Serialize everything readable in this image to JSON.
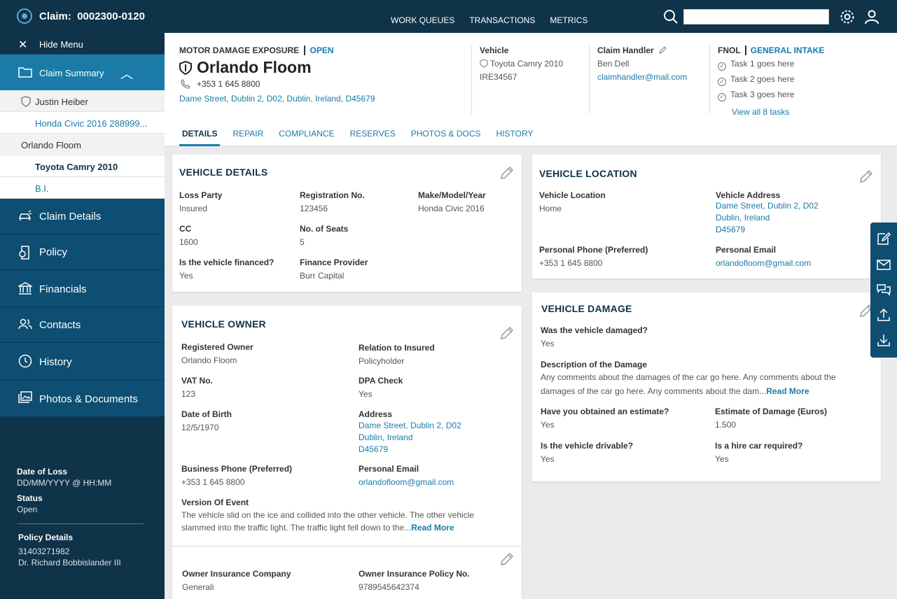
{
  "topbar": {
    "claim_label": "Claim:",
    "claim_number": "0002300-0120",
    "nav": [
      "WORK QUEUES",
      "TRANSACTIONS",
      "METRICS"
    ],
    "search_placeholder": ""
  },
  "sidebar": {
    "hide_menu": "Hide Menu",
    "claim_summary": "Claim Summary",
    "sub_items": [
      {
        "label": "Justin Heiber",
        "type": "party"
      },
      {
        "label": "Honda Civic 2016 288999...",
        "type": "link"
      },
      {
        "label": "Orlando Floom",
        "type": "party"
      },
      {
        "label": "Toyota Camry 2010",
        "type": "active"
      },
      {
        "label": "B.I.",
        "type": "link"
      }
    ],
    "main_items": [
      "Claim Details",
      "Policy",
      "Financials",
      "Contacts",
      "History",
      "Photos & Documents"
    ],
    "date_of_loss_label": "Date of Loss",
    "date_of_loss_value": "DD/MM/YYYY @ HH:MM",
    "status_label": "Status",
    "status_value": "Open",
    "policy_details_label": "Policy Details",
    "policy_number": "31403271982",
    "policy_holder": "Dr. Richard Bobbislander III"
  },
  "header": {
    "exposure": "MOTOR DAMAGE EXPOSURE",
    "exposure_status": "OPEN",
    "name": "Orlando Floom",
    "phone": "+353 1 645 8800",
    "address": "Dame Street, Dublin 2, D02, Dublin, Ireland, D45679",
    "vehicle_label": "Vehicle",
    "vehicle_name": "Toyota Camry 2010",
    "vehicle_reg": "IRE34567",
    "handler_label": "Claim Handler",
    "handler_name": "Ben Dell",
    "handler_email": "claimhandler@mail.com",
    "fnol_label": "FNOL",
    "fnol_intake": "GENERAL INTAKE",
    "tasks": [
      "Task 1 goes here",
      "Task 2 goes here",
      "Task 3 goes here"
    ],
    "view_all": "View all 8 tasks",
    "tabs": [
      "DETAILS",
      "REPAIR",
      "COMPLIANCE",
      "RESERVES",
      "PHOTOS & DOCS",
      "HISTORY"
    ]
  },
  "vehicle_details": {
    "title": "VEHICLE DETAILS",
    "loss_party_k": "Loss Party",
    "loss_party_v": "Insured",
    "reg_k": "Registration No.",
    "reg_v": "123456",
    "make_k": "Make/Model/Year",
    "make_v": "Honda Civic 2016",
    "cc_k": "CC",
    "cc_v": "1600",
    "seats_k": "No. of Seats",
    "seats_v": "5",
    "financed_k": "Is the vehicle financed?",
    "financed_v": "Yes",
    "provider_k": "Finance Provider",
    "provider_v": "Burr Capital"
  },
  "vehicle_owner": {
    "title": "VEHICLE OWNER",
    "reg_owner_k": "Registered Owner",
    "reg_owner_v": "Orlando Floom",
    "relation_k": "Relation to Insured",
    "relation_v": "Policyholder",
    "vat_k": "VAT No.",
    "vat_v": "123",
    "dpa_k": "DPA Check",
    "dpa_v": "Yes",
    "dob_k": "Date of Birth",
    "dob_v": "12/5/1970",
    "address_k": "Address",
    "address_l1": "Dame Street, Dublin 2, D02",
    "address_l2": "Dublin, Ireland",
    "address_l3": "D45679",
    "biz_phone_k": "Business Phone (Preferred)",
    "biz_phone_v": "+353 1 645 8800",
    "email_k": "Personal Email",
    "email_v": "orlandofloom@gmail.com",
    "event_k": "Version Of Event",
    "event_v": "The vehicle slid on the ice and collided into the other vehicle. The other vehicle slammed into the traffic light. The traffic light fell down to the...",
    "read_more": "Read More",
    "ins_co_k": "Owner Insurance Company",
    "ins_co_v": "Generali",
    "ins_pol_k": "Owner Insurance Policy No.",
    "ins_pol_v": "9789545642374"
  },
  "vehicle_location": {
    "title": "VEHICLE LOCATION",
    "loc_k": "Vehicle Location",
    "loc_v": "Home",
    "addr_k": "Vehicle Address",
    "addr_l1": "Dame Street, Dublin 2, D02",
    "addr_l2": "Dublin, Ireland",
    "addr_l3": "D45679",
    "phone_k": "Personal Phone (Preferred)",
    "phone_v": "+353 1 645 8800",
    "email_k": "Personal Email",
    "email_v": "orlandofloom@gmail.com"
  },
  "vehicle_damage": {
    "title": "VEHICLE DAMAGE",
    "damaged_k": "Was the vehicle damaged?",
    "damaged_v": "Yes",
    "desc_k": "Description of the Damage",
    "desc_v": "Any comments about the damages of the car go here. Any comments about the damages of the car go here. Any comments about the dam...",
    "read_more": "Read More",
    "estimate_k": "Have you obtained an estimate?",
    "estimate_v": "Yes",
    "estimate_amt_k": "Estimate of Damage (Euros)",
    "estimate_amt_v": "1.500",
    "drivable_k": "Is the vehicle drivable?",
    "drivable_v": "Yes",
    "hire_k": "Is a hire car required?",
    "hire_v": "Yes"
  },
  "colors": {
    "navy": "#0f3349",
    "accent": "#1a7ba8",
    "sidebar_main": "#0e4e72"
  }
}
